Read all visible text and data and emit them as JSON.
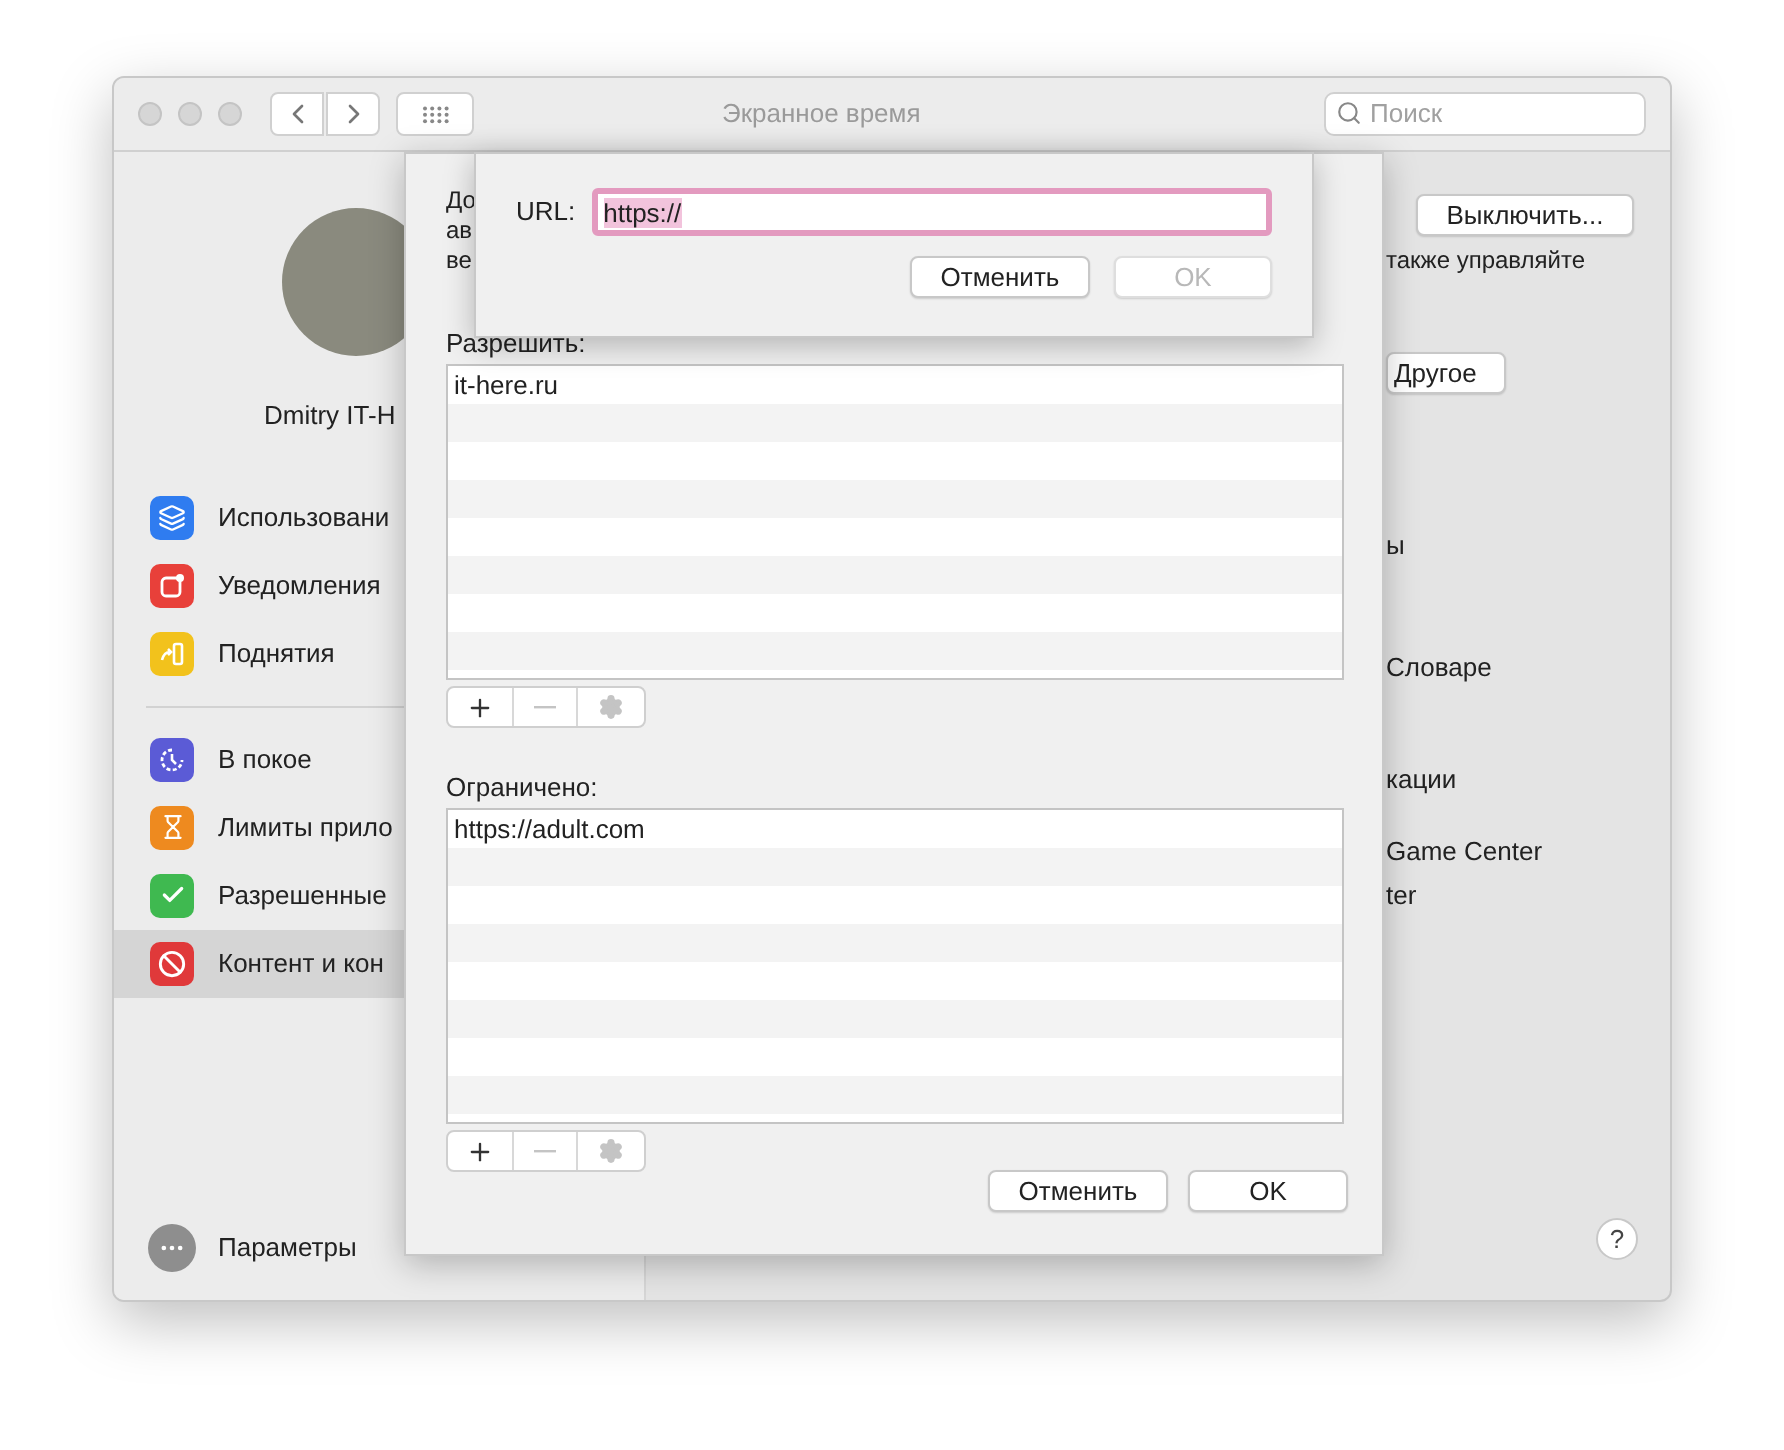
{
  "window": {
    "title": "Экранное время"
  },
  "search": {
    "placeholder": "Поиск"
  },
  "profile": {
    "name": "Dmitry IT-H"
  },
  "sidebar": {
    "items": [
      {
        "kind": "usage",
        "label": "Использовани",
        "selected": false
      },
      {
        "kind": "notifications",
        "label": "Уведомления",
        "selected": false
      },
      {
        "kind": "pickups",
        "label": "Поднятия",
        "selected": false
      },
      {
        "kind": "downtime",
        "label": "В покое",
        "selected": false
      },
      {
        "kind": "limits",
        "label": "Лимиты прило",
        "selected": false
      },
      {
        "kind": "allowed",
        "label": "Разрешенные",
        "selected": false
      },
      {
        "kind": "content",
        "label": "Контент и кон",
        "selected": true
      }
    ],
    "footer": {
      "label": "Параметры"
    }
  },
  "content": {
    "turn_off_button": "Выключить...",
    "note": "также управляйте",
    "other_button": "Другое",
    "lines": [
      "ы",
      "Словаре",
      "кации",
      "Game Center",
      "ter"
    ],
    "help_button": "?"
  },
  "sheet": {
    "intro": [
      "До",
      "ав",
      "ве"
    ],
    "allow": {
      "label": "Разрешить:",
      "rows": [
        "it-here.ru"
      ],
      "toolbar": [
        {
          "kind": "add",
          "disabled": false
        },
        {
          "kind": "remove",
          "disabled": true
        },
        {
          "kind": "action",
          "disabled": true
        }
      ]
    },
    "restrict": {
      "label": "Ограничено:",
      "rows": [
        "https://adult.com"
      ],
      "toolbar": [
        {
          "kind": "add",
          "disabled": false
        },
        {
          "kind": "remove",
          "disabled": true
        },
        {
          "kind": "action",
          "disabled": true
        }
      ]
    },
    "buttons": [
      {
        "label": "Отменить",
        "disabled": false
      },
      {
        "label": "OK",
        "disabled": false
      }
    ]
  },
  "url_sheet": {
    "label": "URL:",
    "value": "https://",
    "buttons": [
      {
        "label": "Отменить",
        "disabled": false
      },
      {
        "label": "OK",
        "disabled": true
      }
    ]
  }
}
